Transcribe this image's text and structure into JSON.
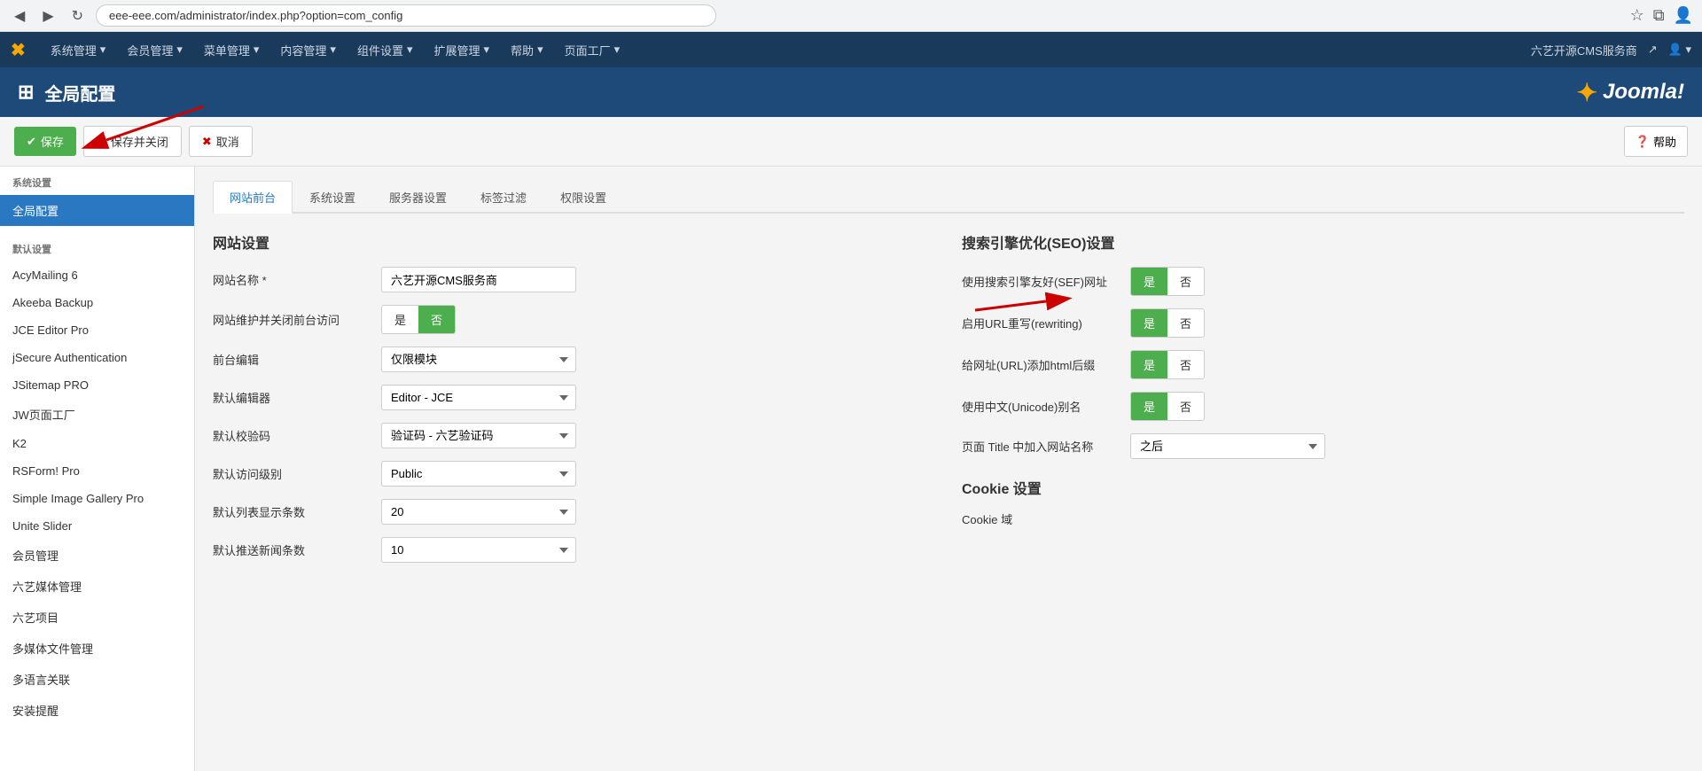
{
  "browser": {
    "back_btn": "◀",
    "forward_btn": "▶",
    "refresh_btn": "↻",
    "address": "eee-eee.com/administrator/index.php?option=com_config",
    "star_icon": "☆",
    "extensions_icon": "⧉",
    "profile_icon": "👤"
  },
  "topnav": {
    "logo": "✖",
    "items": [
      {
        "label": "系统管理",
        "has_arrow": true
      },
      {
        "label": "会员管理",
        "has_arrow": true
      },
      {
        "label": "菜单管理",
        "has_arrow": true
      },
      {
        "label": "内容管理",
        "has_arrow": true
      },
      {
        "label": "组件设置",
        "has_arrow": true
      },
      {
        "label": "扩展管理",
        "has_arrow": true
      },
      {
        "label": "帮助",
        "has_arrow": true
      },
      {
        "label": "页面工厂",
        "has_arrow": true
      }
    ],
    "right_label": "六艺开源CMS服务商",
    "right_icon": "↗",
    "user_icon": "👤"
  },
  "page_header": {
    "grid_icon": "⊞",
    "title": "全局配置",
    "joomla_brand": "Joomla!"
  },
  "toolbar": {
    "save_label": "保存",
    "save_close_label": "保存并关闭",
    "cancel_label": "取消",
    "help_label": "帮助",
    "question_icon": "?"
  },
  "sidebar": {
    "section_title": "系统设置",
    "active_item": "全局配置",
    "items": [
      {
        "label": "全局配置",
        "active": true
      },
      {
        "label": "默认设置"
      },
      {
        "label": "AcyMailing 6"
      },
      {
        "label": "Akeeba Backup"
      },
      {
        "label": "JCE Editor Pro"
      },
      {
        "label": "jSecure Authentication"
      },
      {
        "label": "JSitemap PRO"
      },
      {
        "label": "JW页面工厂"
      },
      {
        "label": "K2"
      },
      {
        "label": "RSForm! Pro"
      },
      {
        "label": "Simple Image Gallery Pro"
      },
      {
        "label": "Unite Slider"
      },
      {
        "label": "会员管理"
      },
      {
        "label": "六艺媒体管理"
      },
      {
        "label": "六艺项目"
      },
      {
        "label": "多媒体文件管理"
      },
      {
        "label": "多语言关联"
      },
      {
        "label": "安装提醒"
      }
    ]
  },
  "tabs": [
    {
      "label": "网站前台",
      "active": true
    },
    {
      "label": "系统设置"
    },
    {
      "label": "服务器设置"
    },
    {
      "label": "标签过滤"
    },
    {
      "label": "权限设置"
    }
  ],
  "website_settings": {
    "title": "网站设置",
    "fields": [
      {
        "label": "网站名称 *",
        "type": "text",
        "value": "六艺开源CMS服务商"
      },
      {
        "label": "网站维护并关闭前台访问",
        "type": "toggle",
        "yes": "是",
        "no": "否",
        "active": "no"
      },
      {
        "label": "前台编辑",
        "type": "select",
        "value": "仅限模块"
      },
      {
        "label": "默认编辑器",
        "type": "select",
        "value": "Editor - JCE"
      },
      {
        "label": "默认校验码",
        "type": "select",
        "value": "验证码 - 六艺验证码"
      },
      {
        "label": "默认访问级别",
        "type": "select",
        "value": "Public"
      },
      {
        "label": "默认列表显示条数",
        "type": "select",
        "value": "20"
      },
      {
        "label": "默认推送新闻条数",
        "type": "select",
        "value": "10"
      }
    ]
  },
  "seo_settings": {
    "title": "搜索引擎优化(SEO)设置",
    "fields": [
      {
        "label": "使用搜索引擎友好(SEF)网址",
        "type": "toggle",
        "yes": "是",
        "no": "否",
        "active": "yes"
      },
      {
        "label": "启用URL重写(rewriting)",
        "type": "toggle",
        "yes": "是",
        "no": "否",
        "active": "yes"
      },
      {
        "label": "给网址(URL)添加html后缀",
        "type": "toggle",
        "yes": "是",
        "no": "否",
        "active": "yes"
      },
      {
        "label": "使用中文(Unicode)别名",
        "type": "toggle",
        "yes": "是",
        "no": "否",
        "active": "yes"
      },
      {
        "label": "页面 Title 中加入网站名称",
        "type": "select",
        "value": "之后"
      }
    ]
  },
  "cookie_settings": {
    "title": "Cookie 设置",
    "cookie_domain_label": "Cookie 域"
  }
}
